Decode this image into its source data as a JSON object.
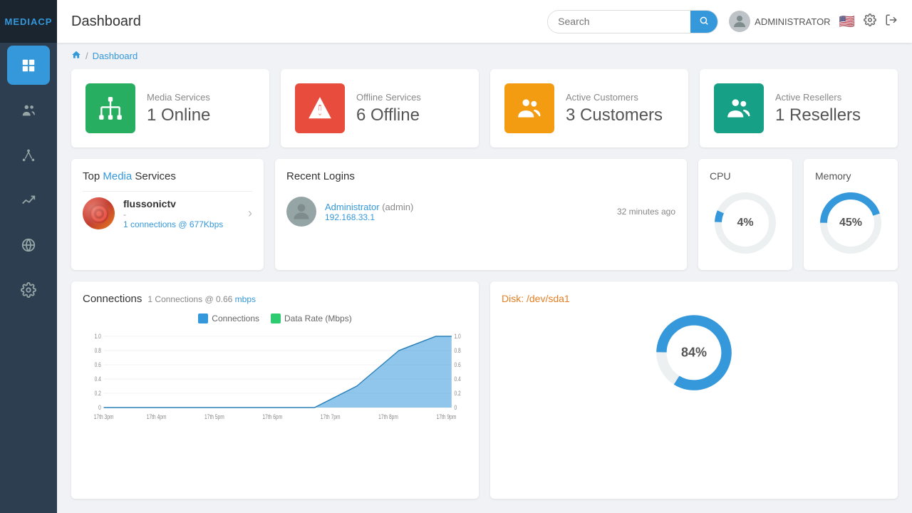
{
  "app": {
    "logo": "MEDIACP",
    "title": "Dashboard"
  },
  "header": {
    "title": "Dashboard",
    "search_placeholder": "Search",
    "search_value": "",
    "admin_name": "ADMINISTRATOR"
  },
  "breadcrumb": {
    "home": "🏠",
    "separator": "/",
    "current": "Dashboard"
  },
  "stat_cards": [
    {
      "id": "media-services",
      "icon_type": "green",
      "icon": "network",
      "label": "Media Services",
      "value": "1 Online"
    },
    {
      "id": "offline-services",
      "icon_type": "red",
      "icon": "warning",
      "label": "Offline Services",
      "value": "6 Offline"
    },
    {
      "id": "active-customers",
      "icon_type": "orange",
      "icon": "group",
      "label": "Active Customers",
      "value": "3 Customers"
    },
    {
      "id": "active-resellers",
      "icon_type": "teal",
      "icon": "people",
      "label": "Active Resellers",
      "value": "1 Resellers"
    }
  ],
  "top_media": {
    "title_prefix": "Top",
    "title_highlight": "Media",
    "title_suffix": "Services",
    "service": {
      "name": "flussonictv",
      "dash": "-",
      "connections": "1 connections @ 677Kbps"
    }
  },
  "recent_logins": {
    "title": "Recent Logins",
    "login": {
      "name": "Administrator",
      "role": "admin",
      "ip": "192.168.33.1",
      "time": "32 minutes ago"
    }
  },
  "connections": {
    "title": "Connections",
    "subtitle": "1 Connections @ 0.66",
    "mbps_label": "mbps",
    "legend_connections": "Connections",
    "legend_datarate": "Data Rate (Mbps)",
    "x_labels": [
      "17th 3pm",
      "17th 4pm",
      "17th 5pm",
      "17th 6pm",
      "17th 7pm",
      "17th 8pm",
      "17th 9pm"
    ],
    "y_labels": [
      "0",
      "0.2",
      "0.4",
      "0.6",
      "0.8",
      "1.0"
    ],
    "y_right_labels": [
      "0",
      "0.2",
      "0.4",
      "0.6",
      "0.8",
      "1.0"
    ]
  },
  "cpu": {
    "title": "CPU",
    "value": "4%",
    "percent": 4
  },
  "memory": {
    "title": "Memory",
    "value": "45%",
    "percent": 45
  },
  "disk": {
    "title": "Disk: /dev/sda1",
    "value": "84%",
    "percent": 84
  },
  "sidebar": {
    "items": [
      {
        "id": "dashboard",
        "label": "Dashboard",
        "icon": "⊞",
        "active": true
      },
      {
        "id": "users",
        "label": "Users",
        "icon": "👥",
        "active": false
      },
      {
        "id": "network",
        "label": "Network",
        "icon": "⊟",
        "active": false
      },
      {
        "id": "analytics",
        "label": "Analytics",
        "icon": "📈",
        "active": false
      },
      {
        "id": "globe",
        "label": "Globe",
        "icon": "🌐",
        "active": false
      },
      {
        "id": "settings",
        "label": "Settings",
        "icon": "⚙",
        "active": false
      }
    ]
  }
}
